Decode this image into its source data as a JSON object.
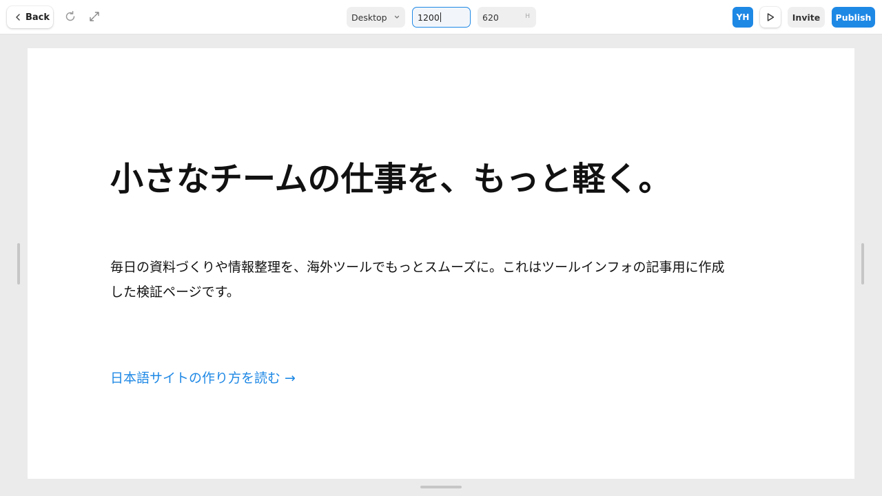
{
  "toolbar": {
    "back_label": "Back",
    "device": "Desktop",
    "width_value": "1200",
    "height_value": "620",
    "height_unit": "H",
    "avatar_initials": "YH",
    "invite_label": "Invite",
    "publish_label": "Publish",
    "icons": [
      "chevron-left-icon",
      "redo-icon",
      "expand-icon",
      "chevron-down-icon",
      "play-icon"
    ]
  },
  "page": {
    "headline": "小さなチームの仕事を、もっと軽く。",
    "body": "毎日の資料づくりや情報整理を、海外ツールでもっとスムーズに。これはツールインフォの記事用に作成した検証ページです。",
    "link_text": "日本語サイトの作り方を読む →"
  },
  "colors": {
    "accent": "#1e88e5",
    "canvas_background": "#ffffff",
    "workspace_background": "#ebebeb"
  }
}
